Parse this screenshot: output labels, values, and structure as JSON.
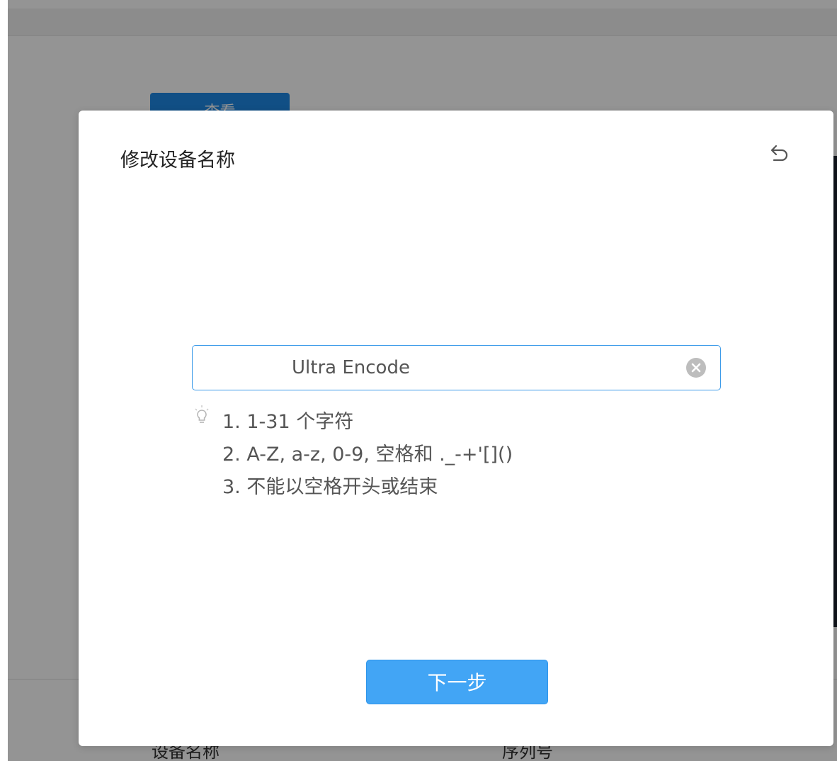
{
  "background": {
    "primary_button_label": "查看",
    "col_header_device_name": "设备名称",
    "col_header_serial": "序列号"
  },
  "dialog": {
    "title": "修改设备名称",
    "back_icon": "undo-arrow-icon",
    "name_input": {
      "value": "Ultra Encode"
    },
    "clear_icon": "clear-circle-icon",
    "hint_icon": "lightbulb-icon",
    "hints": [
      "1. 1-31 个字符",
      "2. A-Z, a-z, 0-9, 空格和 ._-+'[]()",
      "3. 不能以空格开头或结束"
    ],
    "next_button_label": "下一步"
  },
  "colors": {
    "accent": "#42a5f5",
    "input_border": "#3d9be9",
    "overlay": "rgba(0,0,0,0.42)"
  }
}
